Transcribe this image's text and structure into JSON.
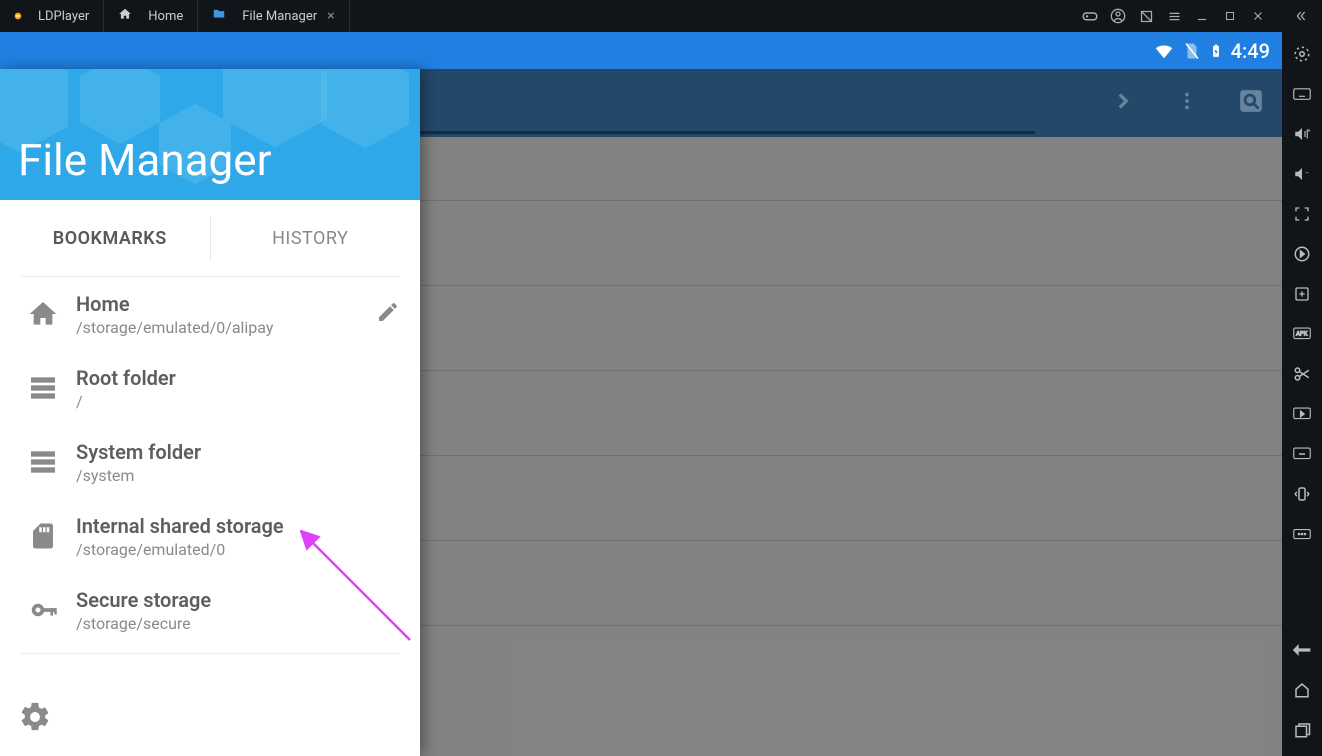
{
  "emulator": {
    "brand": "LDPlayer",
    "tabs": [
      {
        "label": "Home",
        "icon": "home"
      },
      {
        "label": "File Manager",
        "icon": "folder",
        "active": true
      }
    ]
  },
  "android_status": {
    "time": "4:49"
  },
  "drawer": {
    "title": "File Manager",
    "tabs": {
      "bookmarks": "BOOKMARKS",
      "history": "HISTORY",
      "active": "bookmarks"
    },
    "bookmarks": [
      {
        "icon": "home",
        "label": "Home",
        "path": "/storage/emulated/0/alipay",
        "editable": true
      },
      {
        "icon": "storage",
        "label": "Root folder",
        "path": "/"
      },
      {
        "icon": "storage",
        "label": "System folder",
        "path": "/system"
      },
      {
        "icon": "sd",
        "label": "Internal shared storage",
        "path": "/storage/emulated/0"
      },
      {
        "icon": "key",
        "label": "Secure storage",
        "path": "/storage/secure"
      }
    ]
  },
  "colors": {
    "strip": "#207fe0",
    "toolbar": "#274f73",
    "hero": "#2ea8e8",
    "arrow": "#e040fb"
  }
}
